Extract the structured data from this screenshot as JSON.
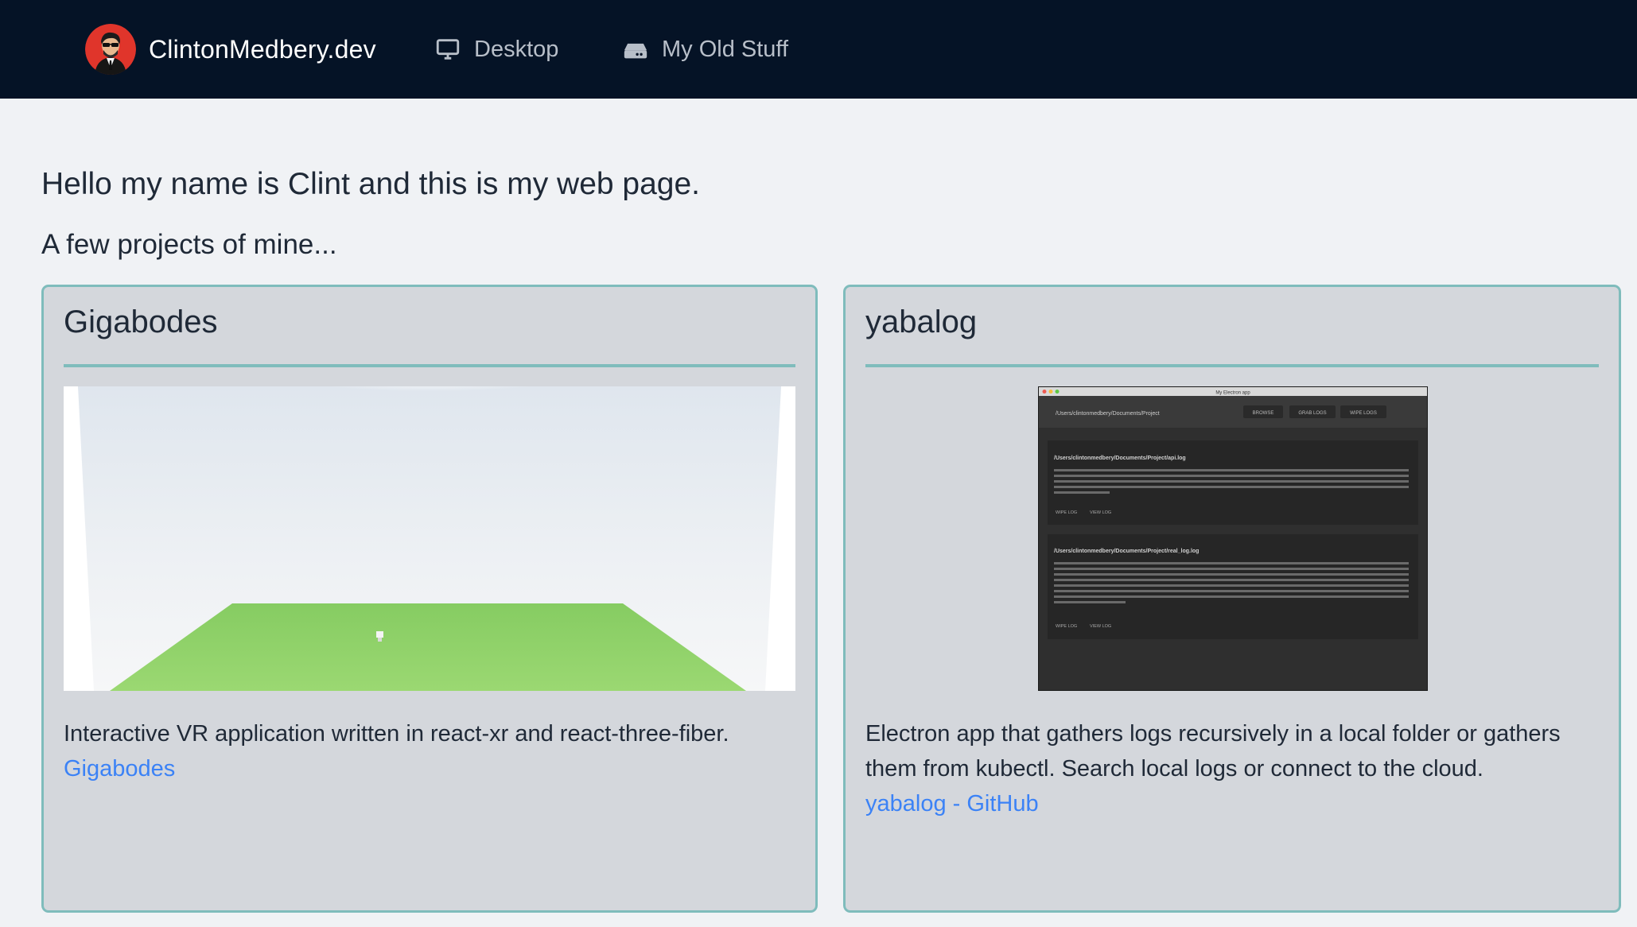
{
  "nav": {
    "brand": "ClintonMedbery.dev",
    "items": [
      {
        "label": "Desktop",
        "icon": "monitor-icon"
      },
      {
        "label": "My Old Stuff",
        "icon": "drive-icon"
      }
    ],
    "background": "#051326"
  },
  "main": {
    "intro": "Hello my name is Clint and this is my web page.",
    "subtitle": "A few projects of mine...",
    "projects": [
      {
        "title": "Gigabodes",
        "description": "Interactive VR application written in react-xr and react-three-fiber.",
        "link": "Gigabodes",
        "image": "vr-scene-screenshot"
      },
      {
        "title": "yabalog",
        "description": "Electron app that gathers logs recursively in a local folder or gathers them from kubectl. Search local logs or connect to the cloud.",
        "link": "yabalog - GitHub",
        "image": "electron-app-screenshot"
      }
    ]
  },
  "electron_shot": {
    "window_title": "My Electron app",
    "path": "/Users/clintonmedbery/Documents/Project",
    "buttons": [
      "BROWSE",
      "GRAB LOGS",
      "WIPE LOGS"
    ],
    "logs": [
      {
        "file": "/Users/clintonmedbery/Documents/Project/api.log",
        "actions": [
          "WIPE LOG",
          "VIEW LOG"
        ]
      },
      {
        "file": "/Users/clintonmedbery/Documents/Project/real_log.log",
        "actions": [
          "WIPE LOG",
          "VIEW LOG"
        ]
      }
    ]
  },
  "colors": {
    "accent": "#7fbcbc",
    "link": "#3b82f6",
    "card_bg": "#d4d7dc",
    "page_bg": "#f0f2f5"
  }
}
